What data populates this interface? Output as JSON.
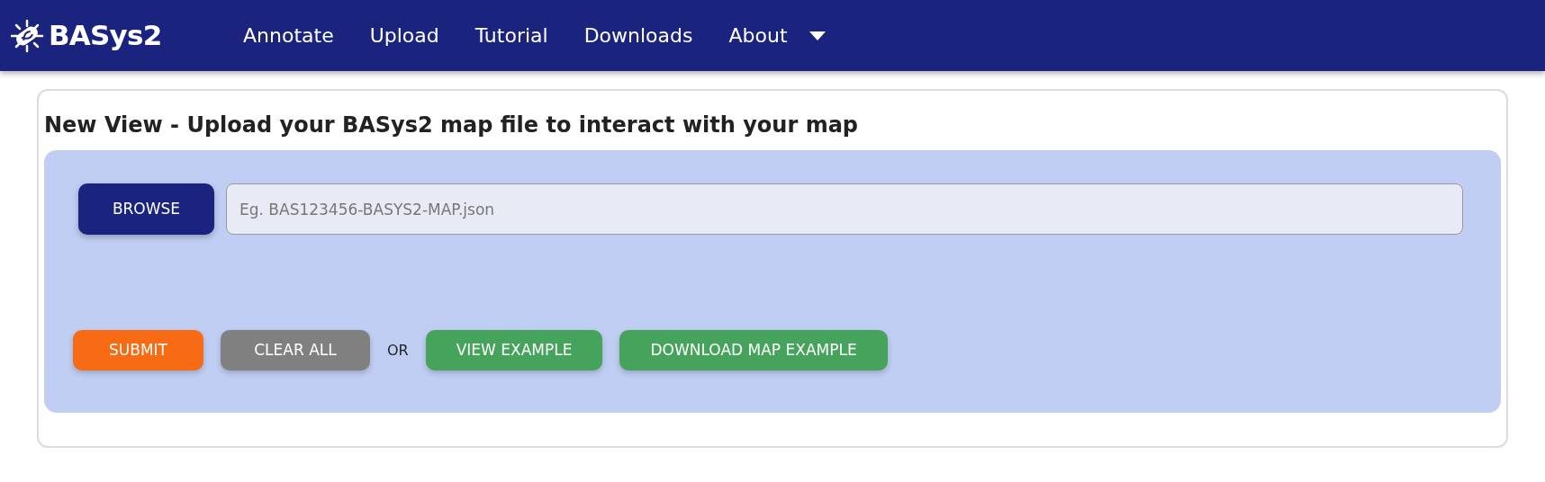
{
  "navbar": {
    "logo": "BASys2",
    "items": [
      {
        "label": "Annotate",
        "dropdown": false
      },
      {
        "label": "Upload",
        "dropdown": false
      },
      {
        "label": "Tutorial",
        "dropdown": false
      },
      {
        "label": "Downloads",
        "dropdown": false
      },
      {
        "label": "About",
        "dropdown": true
      }
    ]
  },
  "card": {
    "title": "New View - Upload your BASys2 map file to interact with your map",
    "browse_button": "BROWSE",
    "file_field": {
      "placeholder": "Eg. BAS123456-BASYS2-MAP.json"
    },
    "actions": [
      {
        "kind": "submit",
        "label": "SUBMIT"
      },
      {
        "kind": "clear",
        "label": "CLEAR ALL"
      },
      {
        "kind": "text",
        "label": "OR"
      },
      {
        "kind": "example",
        "label": "VIEW EXAMPLE"
      },
      {
        "kind": "example",
        "label": "DOWNLOAD MAP EXAMPLE"
      }
    ]
  }
}
